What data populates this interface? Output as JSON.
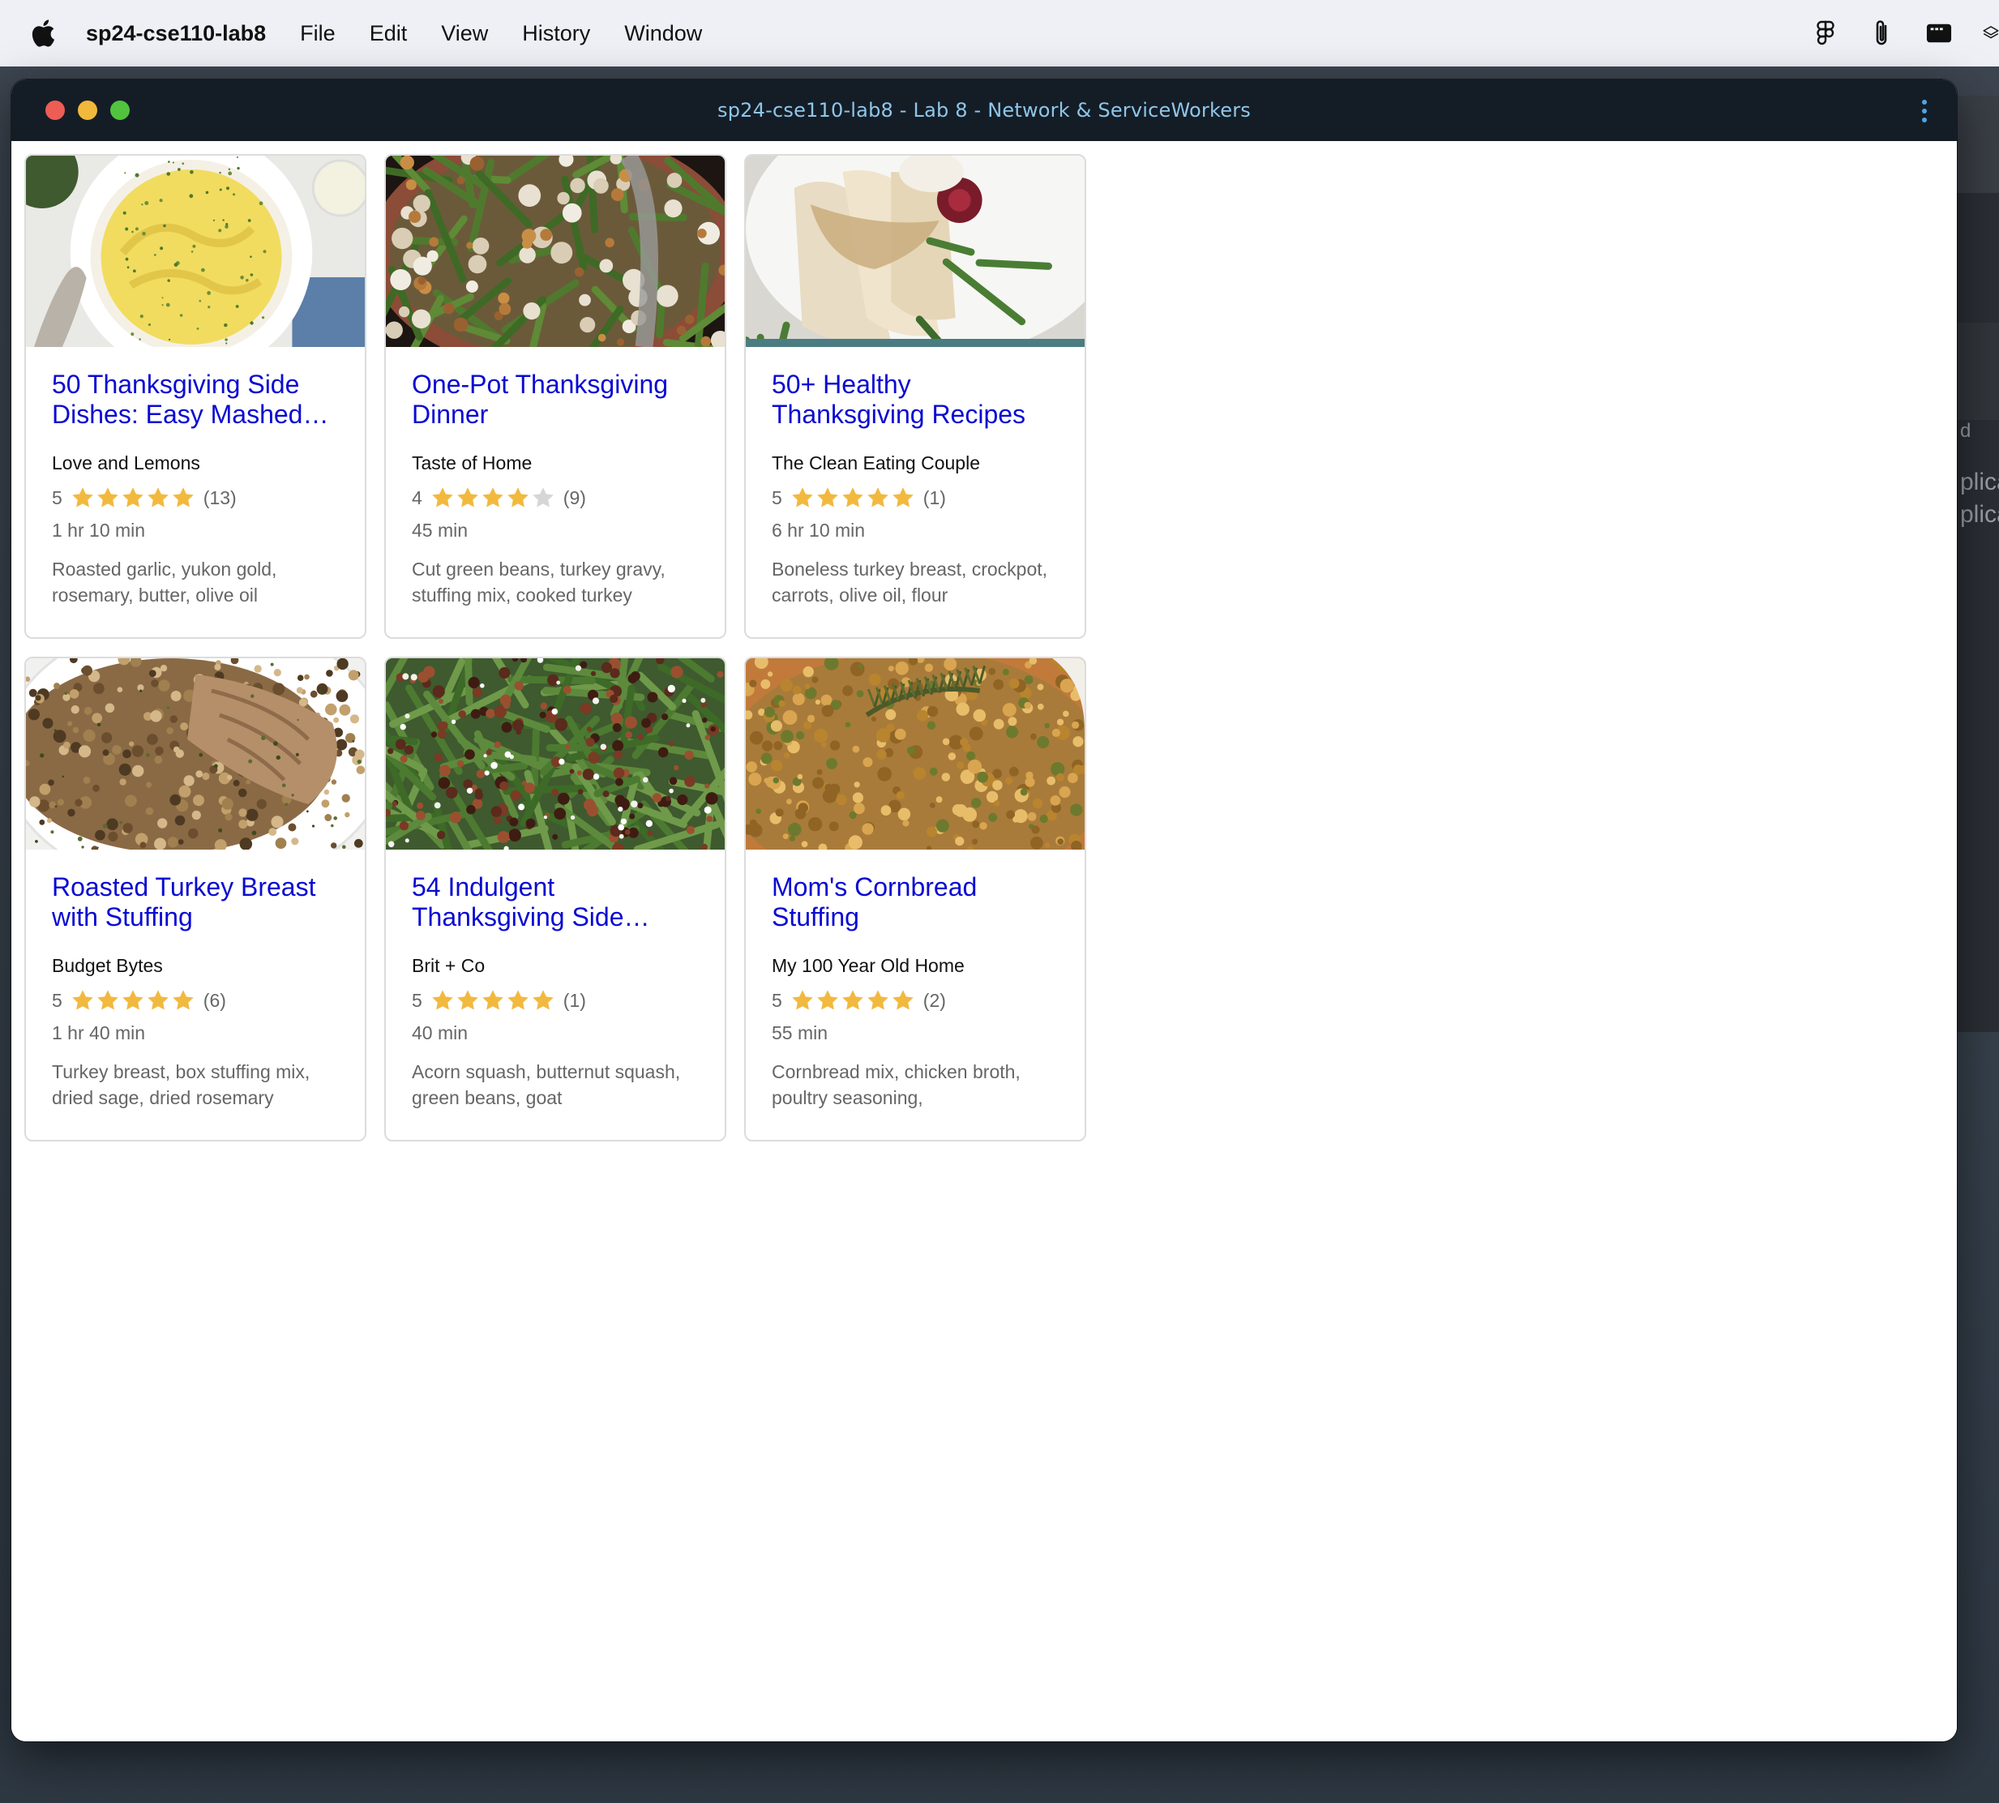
{
  "menubar": {
    "app_name": "sp24-cse110-lab8",
    "items": [
      "File",
      "Edit",
      "View",
      "History",
      "Window"
    ],
    "tray_icons": [
      "figma-icon",
      "paperclip-icon",
      "window-icon",
      "layers-icon"
    ]
  },
  "window": {
    "title": "sp24-cse110-lab8 - Lab 8 - Network & ServiceWorkers"
  },
  "background_app": {
    "texts": [
      "d",
      "plica",
      "plica"
    ]
  },
  "colors": {
    "title_link": "#0a0ad2",
    "star_filled": "#f2b93f",
    "star_empty": "#d6d6d6",
    "titlebar": "#141d26",
    "title_text": "#8fc6ea"
  },
  "recipes": [
    {
      "title": "50 Thanksgiving Side Dishes: Easy Mashed…",
      "org": "Love and Lemons",
      "rating": 5,
      "rating_label": "5",
      "count": "(13)",
      "time": "1 hr 10 min",
      "ingredients": "Roasted garlic, yukon gold, rosemary, butter, olive oil",
      "image": "mashed-potatoes"
    },
    {
      "title": "One-Pot Thanksgiving Dinner",
      "org": "Taste of Home",
      "rating": 4,
      "rating_label": "4",
      "count": "(9)",
      "time": "45 min",
      "ingredients": "Cut green beans, turkey gravy, stuffing mix, cooked turkey",
      "image": "one-pot-dinner"
    },
    {
      "title": "50+ Healthy Thanksgiving Recipes",
      "org": "The Clean Eating Couple",
      "rating": 5,
      "rating_label": "5",
      "count": "(1)",
      "time": "6 hr 10 min",
      "ingredients": "Boneless turkey breast, crockpot, carrots, olive oil, flour",
      "image": "turkey-plate"
    },
    {
      "title": "Roasted Turkey Breast with Stuffing",
      "org": "Budget Bytes",
      "rating": 5,
      "rating_label": "5",
      "count": "(6)",
      "time": "1 hr 40 min",
      "ingredients": "Turkey breast, box stuffing mix, dried sage, dried rosemary",
      "image": "turkey-stuffing"
    },
    {
      "title": "54 Indulgent Thanksgiving Side…",
      "org": "Brit + Co",
      "rating": 5,
      "rating_label": "5",
      "count": "(1)",
      "time": "40 min",
      "ingredients": "Acorn squash, butternut squash, green beans, goat",
      "image": "green-beans-pecans"
    },
    {
      "title": "Mom's Cornbread Stuffing",
      "org": "My 100 Year Old Home",
      "rating": 5,
      "rating_label": "5",
      "count": "(2)",
      "time": "55 min",
      "ingredients": "Cornbread mix, chicken broth, poultry seasoning,",
      "image": "cornbread-stuffing"
    }
  ]
}
